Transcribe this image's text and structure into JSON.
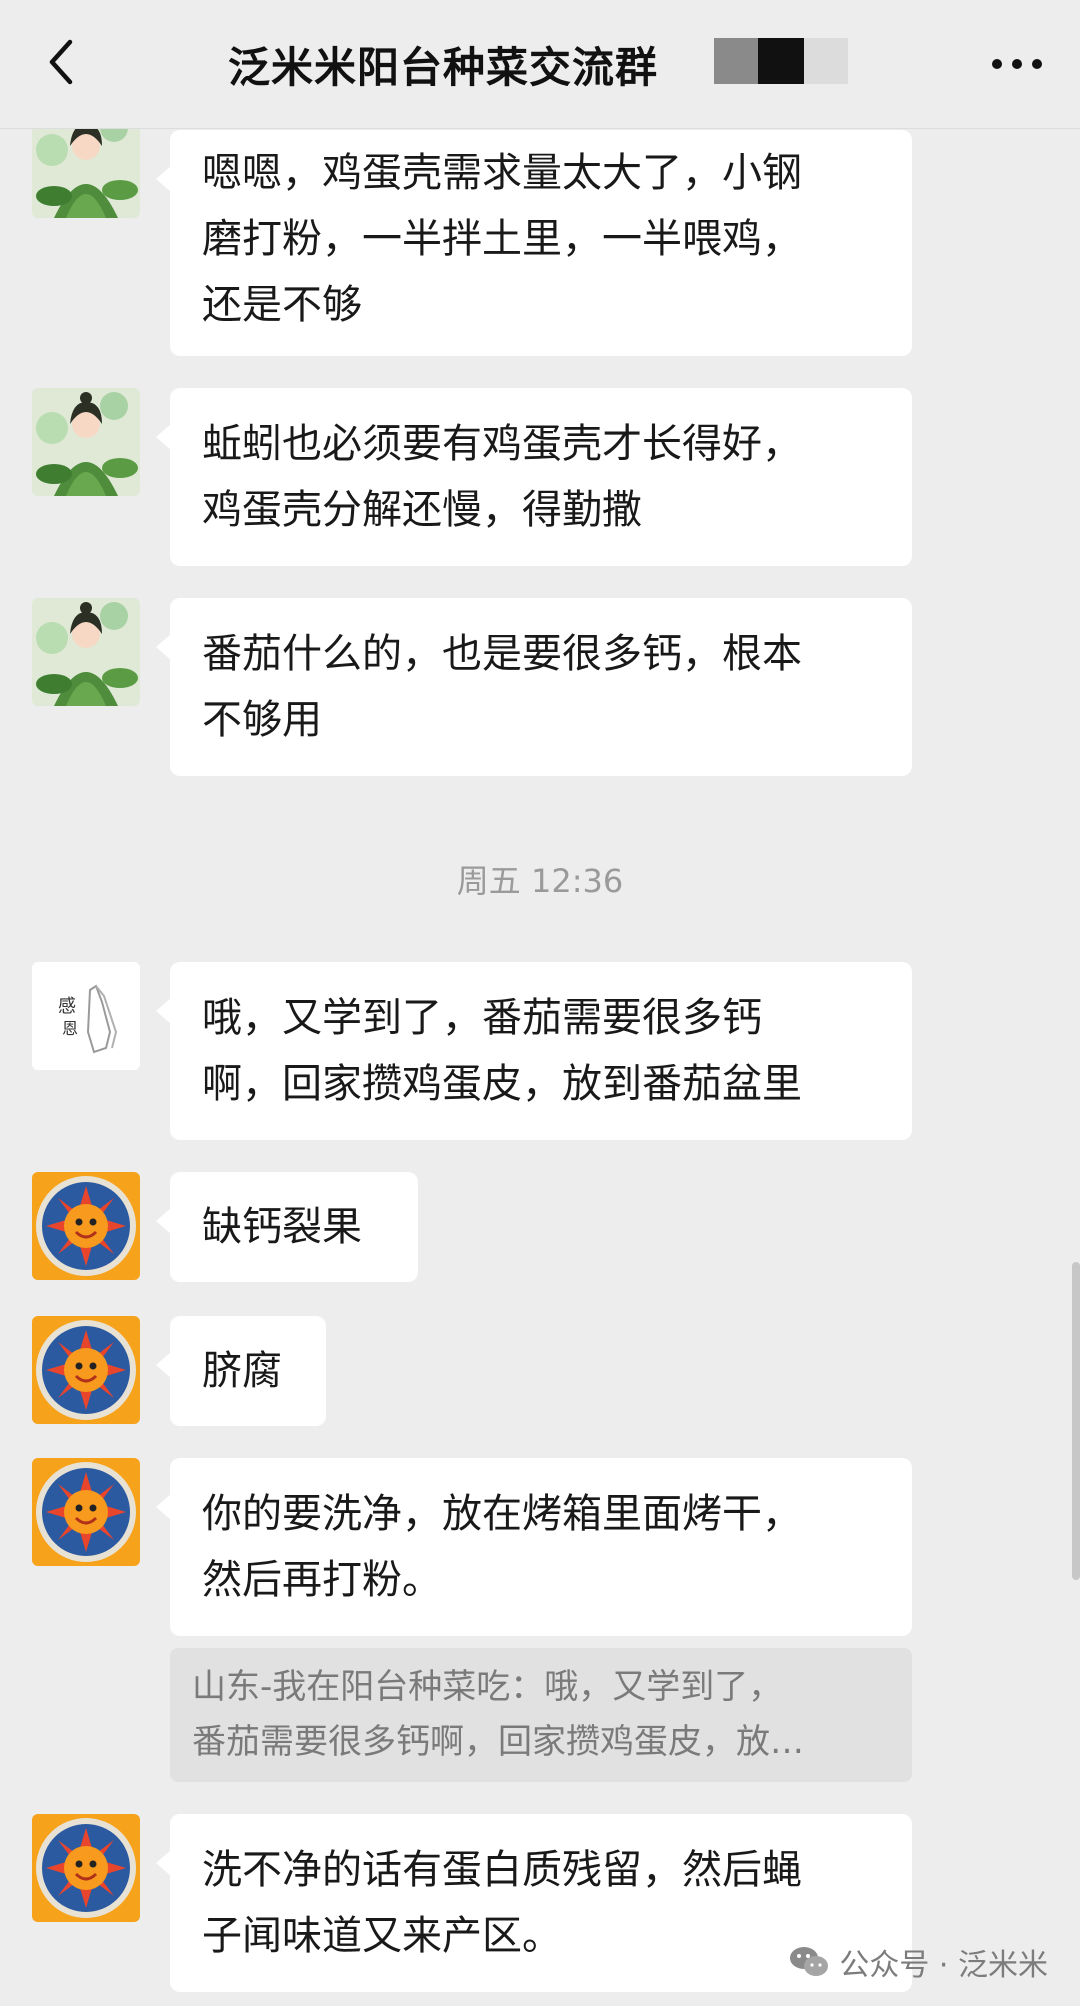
{
  "header": {
    "title": "泛米米阳台种菜交流群",
    "back_icon": "chevron-left-icon",
    "more_icon": "ellipsis-icon"
  },
  "messages": [
    {
      "avatar": "green-fairy-avatar",
      "lines": [
        "嗯嗯，鸡蛋壳需求量太大了，小钢",
        "磨打粉，一半拌土里，一半喂鸡，",
        "还是不够"
      ]
    },
    {
      "avatar": "green-fairy-avatar",
      "lines": [
        "蚯蚓也必须要有鸡蛋壳才长得好，",
        "鸡蛋壳分解还慢，得勤撒"
      ]
    },
    {
      "avatar": "green-fairy-avatar",
      "lines": [
        "番茄什么的，也是要很多钙，根本",
        "不够用"
      ]
    },
    {
      "avatar": "praying-hands-avatar",
      "lines": [
        "哦，又学到了，番茄需要很多钙",
        "啊，回家攒鸡蛋皮，放到番茄盆里"
      ]
    },
    {
      "avatar": "sun-avatar",
      "lines": [
        "缺钙裂果"
      ]
    },
    {
      "avatar": "sun-avatar",
      "lines": [
        "脐腐"
      ]
    },
    {
      "avatar": "sun-avatar",
      "lines": [
        "你的要洗净，放在烤箱里面烤干，",
        "然后再打粉。"
      ]
    },
    {
      "avatar": "sun-avatar",
      "lines": [
        "洗不净的话有蛋白质残留，然后蝇",
        "子闻味道又来产区。"
      ]
    }
  ],
  "timestamp": "周五 12:36",
  "quote": {
    "lines": [
      "山东-我在阳台种菜吃：哦，又学到了，",
      "番茄需要很多钙啊，回家攒鸡蛋皮，放…"
    ]
  },
  "watermark": {
    "text": "公众号 · 泛米米",
    "icon": "wechat-icon"
  },
  "colors": {
    "background": "#ededed",
    "bubble": "#ffffff",
    "quote_bg": "#e1e1e1",
    "timestamp": "#9a9a9a"
  }
}
